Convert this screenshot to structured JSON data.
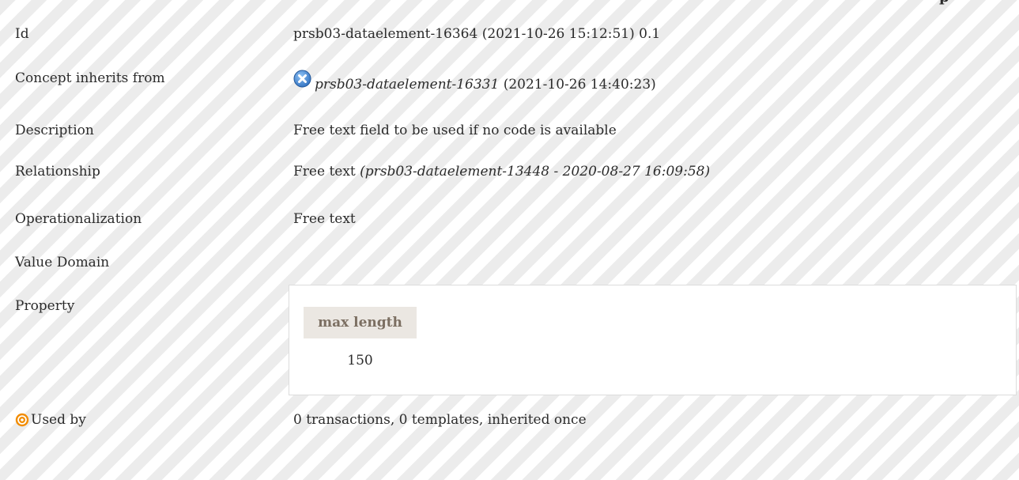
{
  "page": {
    "cut_heading": "p"
  },
  "rows": {
    "id": {
      "label": "Id",
      "value": "prsb03-dataelement-16364 (2021-10-26 15:12:51) 0.1"
    },
    "inherits": {
      "label": "Concept inherits from",
      "link_text": "prsb03-dataelement-16331",
      "suffix": " (2021-10-26 14:40:23)",
      "icon": "cancel-circle-icon"
    },
    "description": {
      "label": "Description",
      "value": "Free text field to be used if no code is available"
    },
    "relationship": {
      "label": "Relationship",
      "value": "Free text ",
      "ref": "(prsb03-dataelement-13448 - 2020-08-27 16:09:58)"
    },
    "operationalization": {
      "label": "Operationalization",
      "value": "Free text"
    },
    "value_domain": {
      "label": "Value Domain"
    },
    "property": {
      "label": "Property",
      "table_header": "max length",
      "table_value": "150"
    },
    "used_by": {
      "label": "Used by",
      "icon": "target-icon",
      "value": "0 transactions, 0 templates, inherited once"
    }
  },
  "colors": {
    "stripe": "#ececec",
    "header_bg": "#ebe7e2",
    "header_text": "#7c6f62",
    "badge": "#4a8fd6",
    "target": "#f28c00"
  }
}
